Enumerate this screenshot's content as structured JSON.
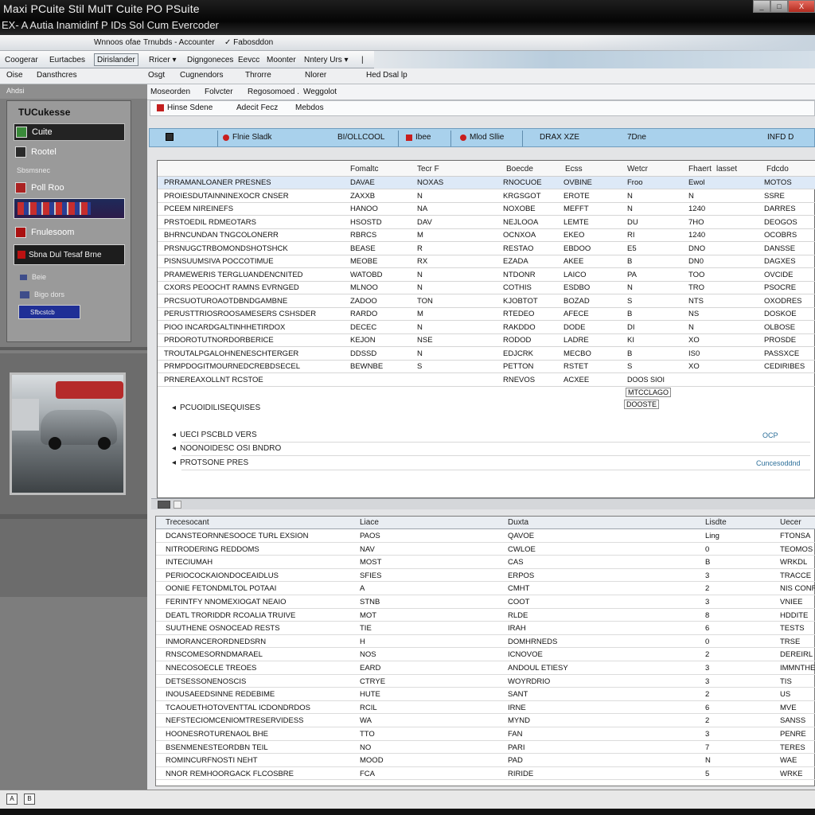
{
  "window": {
    "title": "Maxi PCuite Stil MulT Cuite PO PSuite",
    "subtitle": "EX- A Autia Inamidinf P IDs Sol Cum Evercoder",
    "controls": [
      "_",
      "□",
      "X"
    ]
  },
  "menubar": {
    "items": [
      "Wnnoos ofae",
      "Trnubds - Accounter",
      "✓ Fabosddon"
    ]
  },
  "toolbar1": {
    "items": [
      "Coogerar",
      "Eurtacbes",
      "Dirislander",
      "Rricer ▾",
      "Digngoneces",
      "Eevcc",
      "Moonter",
      "Nntery Urs ▾",
      "|"
    ]
  },
  "toolbar2": {
    "items": [
      "Oise",
      "Dansthcres",
      "Osgt",
      "Cugnendors",
      "Throrre",
      "Nlorer",
      "Hed Dsal lp"
    ]
  },
  "sidebar": {
    "header": "Ahdsi",
    "panel_title": "TUCukesse",
    "items": [
      {
        "label": "Cuite",
        "icon": "gauge-icon"
      },
      {
        "label": "Rootel",
        "icon": "car-icon"
      }
    ],
    "section_label": "Sbsmsnec",
    "section2": "Poll Roo",
    "section3": "Fnulesoom",
    "redbox": "Sbna Dul Tesaf Brne",
    "small_items": [
      "Beie",
      "Bigo dors"
    ],
    "blue_button": "Sfbcstcb"
  },
  "tabs1": [
    "Moseorden",
    "Folvcter",
    "Regosomoed .",
    "Weggolot"
  ],
  "tabs2": [
    "Hinse Sdene",
    "Adecit Fecz",
    "Mebdos"
  ],
  "infobar": {
    "cells": [
      "Flnie Sladk",
      "BI/OLLCOOL",
      "Ibee",
      "Mlod Sllie",
      "DRAX XZE",
      "7Dne",
      "INFD D"
    ]
  },
  "table1": {
    "headers": [
      "",
      "Fomaltc",
      "Tecr F",
      "Boecde",
      "Ecss",
      "Wetcr",
      "Fhaert",
      "lasset",
      "Fdcdo"
    ],
    "rows": [
      [
        "PRRAMANLOANER PRESNES",
        "DAVAE",
        "NOXAS",
        "RNOCUOE",
        "OVBINE",
        "Froo",
        "Ewol",
        "",
        "MOTOS"
      ],
      [
        "PROIESDUTAINNINEXOCR CNSER",
        "ZAXXB",
        "N",
        "KRGSGOT",
        "EROTE",
        "N",
        "N",
        "",
        "SSRE"
      ],
      [
        "PCEEM NIREINEFS",
        "HANOO",
        "NA",
        "NOXOBE",
        "MEFFT",
        "N",
        "1240",
        "",
        "DARRES"
      ],
      [
        "PRSTOEDIL RDMEOTARS",
        "HSOSTD",
        "DAV",
        "NEJLOOA",
        "LEMTE",
        "DU",
        "7HO",
        "",
        "DEOGOS"
      ],
      [
        "BHRNCUNDAN TNGCOLONERR",
        "RBRCS",
        "M",
        "OCNXOA",
        "EKEO",
        "RI",
        "1240",
        "",
        "OCOBRS"
      ],
      [
        "PRSNUGCTRBOMONDSHOTSHCK",
        "BEASE",
        "R",
        "RESTAO",
        "EBDOO",
        "E5",
        "DNO",
        "",
        "DANSSE"
      ],
      [
        "PISNSUUMSIVA POCCOTIMUE",
        "MEOBE",
        "RX",
        "EZADA",
        "AKEE",
        "B",
        "DN0",
        "",
        "DAGXES"
      ],
      [
        "PRAMEWERIS TERGLUANDENCNITED",
        "WATOBD",
        "N",
        "NTDONR",
        "LAICO",
        "PA",
        "TOO",
        "",
        "OVCIDE"
      ],
      [
        "CXORS PEOOCHT RAMNS EVRNGED",
        "MLNOO",
        "N",
        "COTHIS",
        "ESDBO",
        "N",
        "TRO",
        "",
        "PSOCRE"
      ],
      [
        "PRCSUOTUROAOTDBNDGAMBNE",
        "ZADOO",
        "TON",
        "KJOBTOT",
        "BOZAD",
        "S",
        "NTS",
        "",
        "OXODRES"
      ],
      [
        "PERUSTTRIOSROOSAMESERS CSHSDER",
        "RARDO",
        "M",
        "RTEDEO",
        "AFECE",
        "B",
        "NS",
        "",
        "DOSKOE"
      ],
      [
        "PIOO INCARDGALTINHHETIRDOX",
        "DECEC",
        "N",
        "RAKDDO",
        "DODE",
        "DI",
        "N",
        "",
        "OLBOSE"
      ],
      [
        "PRDOROTUTNORDORBERICE",
        "KEJON",
        "NSE",
        "RODOD",
        "LADRE",
        "KI",
        "XO",
        "",
        "PROSDE"
      ],
      [
        "TROUTALPGALOHNENESCHTERGER",
        "DDSSD",
        "N",
        "EDJCRK",
        "MECBO",
        "B",
        "IS0",
        "",
        "PASSXCE"
      ],
      [
        "PRMPDOGITMOURNEDCREBDSECEL",
        "BEWNBE",
        "S",
        "PETTON",
        "RSTET",
        "S",
        "XO",
        "",
        "CEDIRIBES"
      ],
      [
        "PRNEREAXOLLNT RCSTOE",
        "",
        "",
        "RNEVOS",
        "ACXEE",
        "",
        "",
        "",
        ""
      ]
    ],
    "side_values": [
      "DOOS SIOI",
      "MTCCLAGO",
      "DOOSTE"
    ],
    "extra_items": [
      "PCUOIDILISEQUISES",
      "UECI PSCBLD VERS",
      "NOONOIDESC OSI BNDRO",
      "PROTSONE PRES"
    ],
    "extra_links": [
      "OCP",
      "Cuncesoddnd"
    ]
  },
  "table2": {
    "headers": [
      "Trecesocant",
      "Liace",
      "Duxta",
      "Lisdte",
      "Uecer"
    ],
    "rows": [
      [
        "DCANSTEORNNESOOCE TURL EXSION",
        "PAOS",
        "QAVOE",
        "Ling",
        "FTONSA"
      ],
      [
        "NITRODERING REDDOMS",
        "NAV",
        "CWLOE",
        "0",
        "TEOMOS"
      ],
      [
        "INTECIUMAH",
        "MOST",
        "CAS",
        "B",
        "WRKDL"
      ],
      [
        "PERIOCOCKAIONDOCEAIDLUS",
        "SFIES",
        "ERPOS",
        "3",
        "TRACCE"
      ],
      [
        "OONIE FETONDMLTOL POTAAI",
        "A",
        "CMHT",
        "2",
        "NIS CONR"
      ],
      [
        "FERINTFY NNOMEXIOGAT NEAIO",
        "STNB",
        "COOT",
        "3",
        "VNIEE"
      ],
      [
        "DEATL TRORIDDR RCOALIA TRUIVE",
        "MOT",
        "RLDE",
        "8",
        "HDDITE"
      ],
      [
        "SUUTHENE OSNOCEAD RESTS",
        "TIE",
        "IRAH",
        "6",
        "TESTS"
      ],
      [
        "INMORANCERORDNEDSRN",
        "H",
        "DOMHRNEDS",
        "0",
        "TRSE"
      ],
      [
        "RNSCOMESORNDMARAEL",
        "NOS",
        "ICNOVOE",
        "2",
        "DEREIRL"
      ],
      [
        "NNECOSOECLE TREOES",
        "EARD",
        "ANDOUL ETIESY",
        "3",
        "IMMNTHE"
      ],
      [
        "DETSESSONENOSCIS",
        "CTRYE",
        "WOYRDRIO",
        "3",
        "TIS"
      ],
      [
        "INOUSAEEDSINNE REDEBIME",
        "HUTE",
        "SANT",
        "2",
        "US"
      ],
      [
        "TCAOUETHOTOVENTTAL ICDONDRDOS",
        "RCIL",
        "IRNE",
        "6",
        "MVE"
      ],
      [
        "NEFSTECIOMCENIOMTRESERVIDESS",
        "WA",
        "MYND",
        "2",
        "SANSS"
      ],
      [
        "HOONESROTURENAOL BHE",
        "TTO",
        "FAN",
        "3",
        "PENRE"
      ],
      [
        "BSENMENESTEORDBN TEIL",
        "NO",
        "PARI",
        "7",
        "TERES"
      ],
      [
        "ROMINCURFNOSTI NEHT",
        "MOOD",
        "PAD",
        "N",
        "WAE"
      ],
      [
        "NNOR REMHOORGACK FLCOSBRE",
        "FCA",
        "RIRIDE",
        "5",
        "WRKE"
      ]
    ]
  },
  "statusbar": {
    "buttons": [
      "A",
      "B"
    ]
  }
}
